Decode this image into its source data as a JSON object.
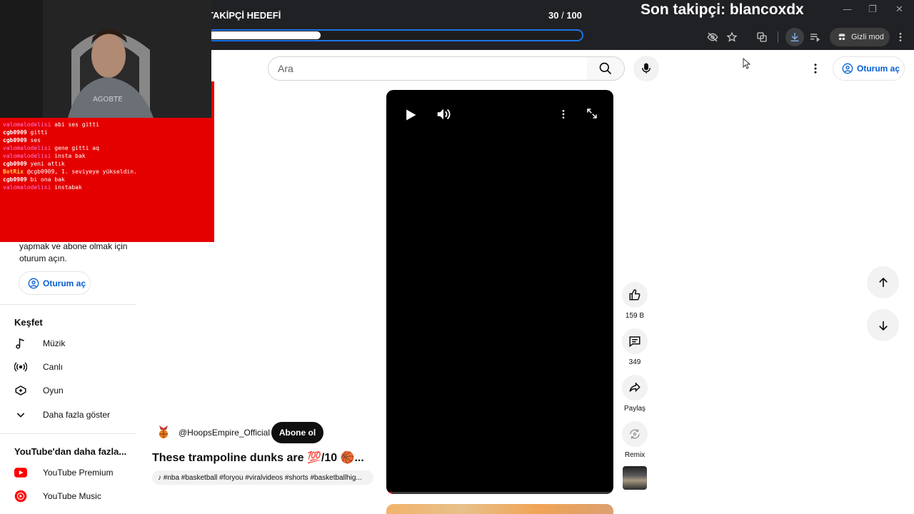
{
  "overlay": {
    "goal_title": "TAKİPÇİ HEDEFİ",
    "goal_current": "30",
    "goal_sep": " / ",
    "goal_target": "100",
    "goal_progress": 0.3,
    "last_follower": "Son takipçi: blancoxdx",
    "chat": [
      {
        "user": "valomalodelisi",
        "msg": "abi ses gitti",
        "style": "a"
      },
      {
        "user": "cgb0909",
        "msg": "gitti",
        "style": "b"
      },
      {
        "user": "cgb0909",
        "msg": "ses",
        "style": "b"
      },
      {
        "user": "valomalodelisi",
        "msg": "gene gitti aq",
        "style": "a"
      },
      {
        "user": "valomalodelisi",
        "msg": "insta bak",
        "style": "a"
      },
      {
        "user": "cgb0909",
        "msg": "yeni attık",
        "style": "b"
      },
      {
        "user": "BotRix",
        "msg": "@cgb0909, 1. seviyeye yükseldin.",
        "style": "c"
      },
      {
        "user": "cgb0909",
        "msg": "bi ona bak",
        "style": "b"
      },
      {
        "user": "valomalodelisi",
        "msg": "instabak",
        "style": "a"
      }
    ]
  },
  "browser": {
    "incognito_label": "Gizli mod"
  },
  "header": {
    "search_placeholder": "Ara",
    "signin_label": "Oturum aç"
  },
  "sidebar": {
    "signin_prompt": "yapmak ve abone olmak için oturum açın.",
    "signin_label": "Oturum aç",
    "explore_heading": "Keşfet",
    "explore_items": [
      {
        "label": "Müzik",
        "icon": "music-note-icon"
      },
      {
        "label": "Canlı",
        "icon": "live-icon"
      },
      {
        "label": "Oyun",
        "icon": "gaming-icon"
      },
      {
        "label": "Daha fazla göster",
        "icon": "chevron-down-icon"
      }
    ],
    "more_heading": "YouTube'dan daha fazla...",
    "more_items": [
      {
        "label": "YouTube Premium",
        "icon": "youtube-premium-icon"
      },
      {
        "label": "YouTube Music",
        "icon": "youtube-music-icon"
      }
    ]
  },
  "short": {
    "channel": "@HoopsEmpire_Official",
    "subscribe_label": "Abone ol",
    "title": "These trampoline dunks are 💯/10 🏀...",
    "tags": "♪ #nba #basketball #foryou #viralvideos #shorts #basketballhig...",
    "likes": "159 B",
    "comments": "349",
    "share_label": "Paylaş",
    "remix_label": "Remix"
  },
  "colors": {
    "chrome": "#202124",
    "chat_bg": "#e50000",
    "accent_blue": "#065fd4",
    "goal_border": "#1a73e8"
  }
}
